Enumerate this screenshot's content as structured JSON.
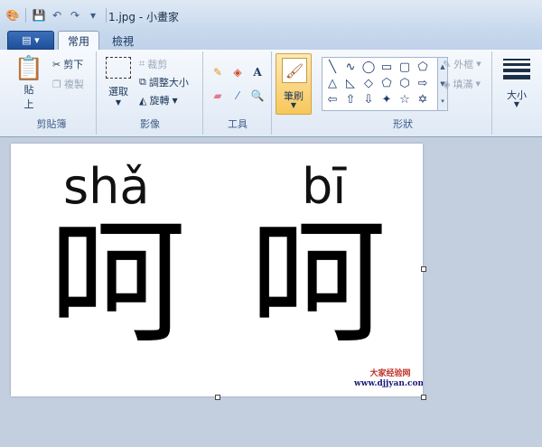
{
  "window": {
    "title": "1.jpg - 小畫家"
  },
  "tabs": {
    "home": "常用",
    "view": "檢視"
  },
  "clipboard": {
    "paste": "貼上",
    "cut": "剪下",
    "copy": "複製",
    "label": "剪貼簿"
  },
  "image": {
    "select": "選取",
    "crop": "裁剪",
    "resize": "調整大小",
    "rotate": "旋轉",
    "label": "影像"
  },
  "tools": {
    "label": "工具"
  },
  "brushes": {
    "label": "筆刷"
  },
  "shapes": {
    "outline": "外框",
    "fill": "填滿",
    "label": "形狀"
  },
  "size": {
    "label": "大小"
  },
  "canvas_content": {
    "pinyin_left": "shǎ",
    "pinyin_right": "bī",
    "hanzi_left": "呵",
    "hanzi_right": "呵",
    "watermark_line1": "大家经验网",
    "watermark_line2": "www.djjyan.com"
  },
  "colors": {
    "accent": "#f7c75a",
    "appmenu": "#2a5ea8",
    "workspace": "#c3cfde"
  }
}
